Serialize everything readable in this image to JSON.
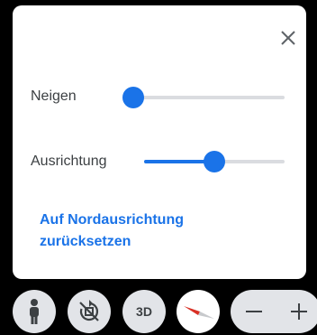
{
  "panel": {
    "tilt": {
      "label": "Neigen",
      "value": 0
    },
    "orientation": {
      "label": "Ausrichtung",
      "value": 0.5
    },
    "reset_link": "Auf Nordausrichtung zurücksetzen",
    "close_icon": "close-icon"
  },
  "toolbar": {
    "pegman_icon": "pegman-icon",
    "rotate_icon": "rotate-disabled-icon",
    "three_d_label": "3D",
    "compass_icon": "compass-icon",
    "zoom_out_icon": "minus-icon",
    "zoom_in_icon": "plus-icon"
  },
  "colors": {
    "accent": "#1a73e8",
    "track": "#dadce0",
    "button_bg": "#e2e4e8",
    "compass_red": "#d93025"
  }
}
